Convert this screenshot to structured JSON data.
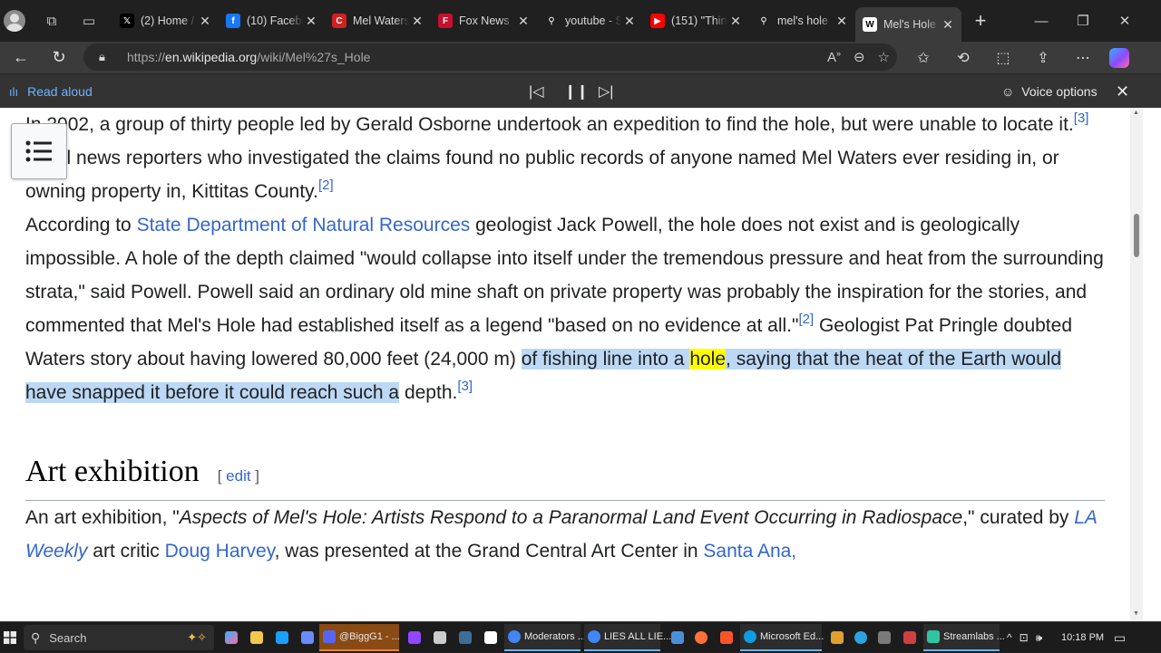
{
  "tabs": [
    {
      "title": "(2) Home /",
      "favicon": "x-icon",
      "fav_glyph": "𝕏",
      "color": "#000000"
    },
    {
      "title": "(10) Facebo",
      "favicon": "facebook-icon",
      "fav_glyph": "f",
      "color": "#1877f2"
    },
    {
      "title": "Mel Waters",
      "favicon": "mel-icon",
      "fav_glyph": "C",
      "color": "#d02020"
    },
    {
      "title": "Fox News",
      "favicon": "fox-icon",
      "fav_glyph": "F",
      "color": "#c8102e"
    },
    {
      "title": "youtube - S",
      "favicon": "search-icon",
      "fav_glyph": "⚲",
      "color": "#202020"
    },
    {
      "title": "(151) \"Thin",
      "favicon": "youtube-icon",
      "fav_glyph": "▶",
      "color": "#ff0000"
    },
    {
      "title": "mel's hole",
      "favicon": "search-icon",
      "fav_glyph": "⚲",
      "color": "#202020"
    },
    {
      "title": "Mel's Hole",
      "favicon": "wikipedia-icon",
      "fav_glyph": "W",
      "color": "#ffffff"
    }
  ],
  "address": {
    "prefix": "https://",
    "domain": "en.wikipedia.org",
    "path": "/wiki/Mel%27s_Hole"
  },
  "read_aloud": {
    "label": "Read aloud",
    "voice_options": "Voice options"
  },
  "article": {
    "p1": {
      "t1": "In 2002, a group of thirty people led by Gerald Osborne undertook an expedition to find the hole, but were unable to locate it.",
      "ref1": "[3]",
      "t2": " Local news reporters who investigated the claims found no public records of anyone named Mel Waters ever residing in, or owning property in, Kittitas County.",
      "ref2": "[2]"
    },
    "p2": {
      "t1": "According to ",
      "link1": "State Department of Natural Resources",
      "t2": " geologist Jack Powell, the hole does not exist and is geologically impossible. A hole of the depth claimed \"would collapse into itself under the tremendous pressure and heat from the surrounding strata,\" said Powell. Powell said an ordinary old mine shaft on private property was probably the inspiration for the stories, and commented that Mel's Hole had established itself as a legend \"based on no evidence at all.\"",
      "ref1": "[2]",
      "t3": " Geologist Pat Pringle doubted Waters story about having lowered 80,000 feet (24,000 m)",
      "sel1": "of fishing line into a ",
      "highlight": "hole",
      "sel2": ", saying that the heat of the Earth would have snapped it before it could reach such a",
      "t4": "depth.",
      "ref2": "[3]"
    },
    "heading": "Art exhibition",
    "edit_open": "[ ",
    "edit_label": "edit",
    "edit_close": " ]",
    "p3": {
      "t1": "An art exhibition, \"",
      "i1": "Aspects of Mel's Hole: Artists Respond to a Paranormal Land Event Occurring in Radiospace",
      "t2": ",\" curated by ",
      "link1": "LA Weekly",
      "t3": " art critic ",
      "link2": "Doug Harvey",
      "t4": ", was presented at the Grand Central Art Center in ",
      "link3": "Santa Ana,"
    }
  },
  "taskbar": {
    "search_label": "Search",
    "apps": [
      {
        "label": "@BiggG1 - ...",
        "color": "#5865f2"
      },
      {
        "label": "Moderators ...",
        "color": "#4285f4"
      },
      {
        "label": "LIES ALL LIE...",
        "color": "#4285f4"
      },
      {
        "label": "Microsoft Ed...",
        "color": "#0c9ee0"
      },
      {
        "label": "Streamlabs ...",
        "color": "#31c3a2"
      }
    ],
    "time": "10:18 PM"
  }
}
